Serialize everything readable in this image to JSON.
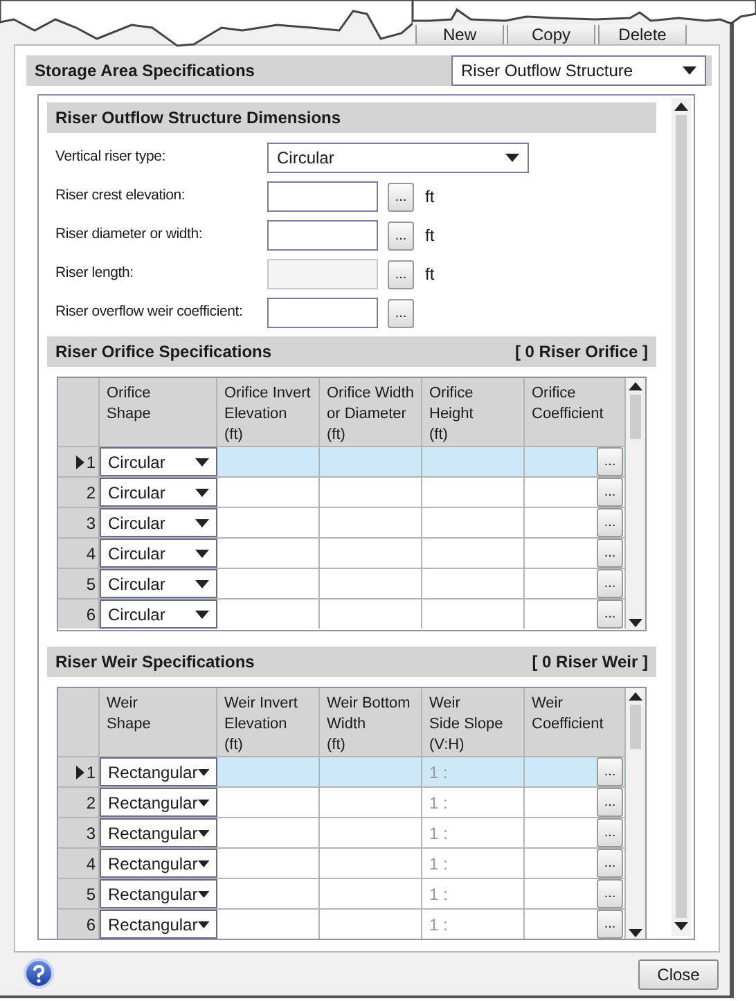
{
  "toolbar_buttons": [
    "New",
    "Copy",
    "Delete"
  ],
  "panel": {
    "title": "Storage Area Specifications",
    "view_select": "Riser Outflow Structure"
  },
  "dimensions": {
    "title": "Riser Outflow Structure Dimensions",
    "fields": [
      {
        "kind": "select",
        "label": "Vertical riser type:",
        "value": "Circular"
      },
      {
        "kind": "number",
        "label": "Riser crest elevation:",
        "button": "...",
        "unit": "ft",
        "disabled": false
      },
      {
        "kind": "number",
        "label": "Riser diameter or width:",
        "button": "...",
        "unit": "ft",
        "disabled": false
      },
      {
        "kind": "number",
        "label": "Riser length:",
        "button": "...",
        "unit": "ft",
        "disabled": true
      },
      {
        "kind": "number",
        "label": "Riser overflow weir coefficient:",
        "button": "...",
        "disabled": false
      }
    ]
  },
  "tables": [
    {
      "title": "Riser Orifice Specifications",
      "count": "[ 0 Riser Orifice ]",
      "columns": [
        "Orifice\nShape",
        "Orifice Invert\nElevation\n(ft)",
        "Orifice Width\nor Diameter\n(ft)",
        "Orifice\nHeight\n(ft)",
        "Orifice\nCoefficient"
      ],
      "rows": [
        {
          "number": "1",
          "selected": true,
          "shape": "Circular",
          "button": "..."
        },
        {
          "number": "2",
          "selected": false,
          "shape": "Circular",
          "button": "..."
        },
        {
          "number": "3",
          "selected": false,
          "shape": "Circular",
          "button": "..."
        },
        {
          "number": "4",
          "selected": false,
          "shape": "Circular",
          "button": "..."
        },
        {
          "number": "5",
          "selected": false,
          "shape": "Circular",
          "button": "..."
        },
        {
          "number": "6",
          "selected": false,
          "shape": "Circular",
          "button": "..."
        }
      ]
    },
    {
      "title": "Riser Weir Specifications",
      "count": "[ 0 Riser Weir ]",
      "columns": [
        "Weir\nShape",
        "Weir Invert\nElevation\n(ft)",
        "Weir Bottom\nWidth\n(ft)",
        "Weir\nSide Slope\n(V:H)",
        "Weir\nCoefficient"
      ],
      "rows": [
        {
          "number": "1",
          "selected": true,
          "shape": "Rectangular",
          "side_slope": "1 :",
          "button": "..."
        },
        {
          "number": "2",
          "selected": false,
          "shape": "Rectangular",
          "side_slope": "1 :",
          "button": "..."
        },
        {
          "number": "3",
          "selected": false,
          "shape": "Rectangular",
          "side_slope": "1 :",
          "button": "..."
        },
        {
          "number": "4",
          "selected": false,
          "shape": "Rectangular",
          "side_slope": "1 :",
          "button": "..."
        },
        {
          "number": "5",
          "selected": false,
          "shape": "Rectangular",
          "side_slope": "1 :",
          "button": "..."
        },
        {
          "number": "6",
          "selected": false,
          "shape": "Rectangular",
          "side_slope": "1 :",
          "button": "..."
        }
      ]
    }
  ],
  "footer": {
    "close_button": "Close"
  }
}
